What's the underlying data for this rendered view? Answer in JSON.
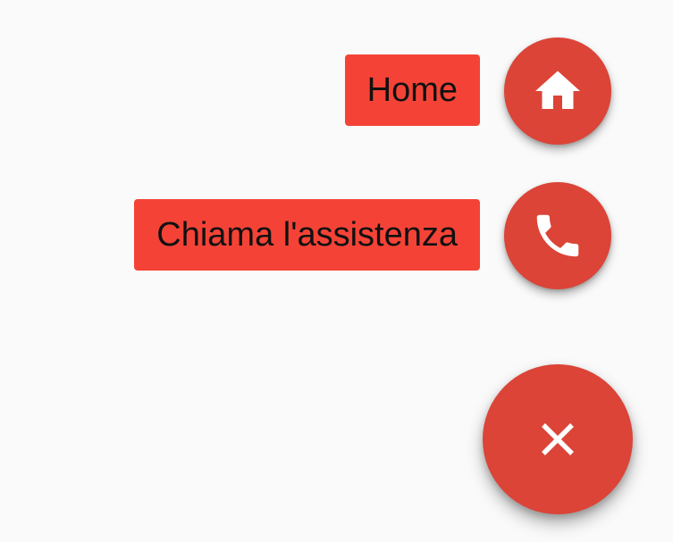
{
  "colors": {
    "background": "#fafafa",
    "fab": "#db4437",
    "label_background": "#f44336",
    "label_text": "#111111",
    "icon": "#ffffff"
  },
  "speed_dial": {
    "actions": [
      {
        "label": "Home",
        "icon": "home-icon"
      },
      {
        "label": "Chiama l'assistenza",
        "icon": "phone-icon"
      }
    ],
    "main_button": {
      "icon": "close-icon",
      "state": "open"
    }
  }
}
